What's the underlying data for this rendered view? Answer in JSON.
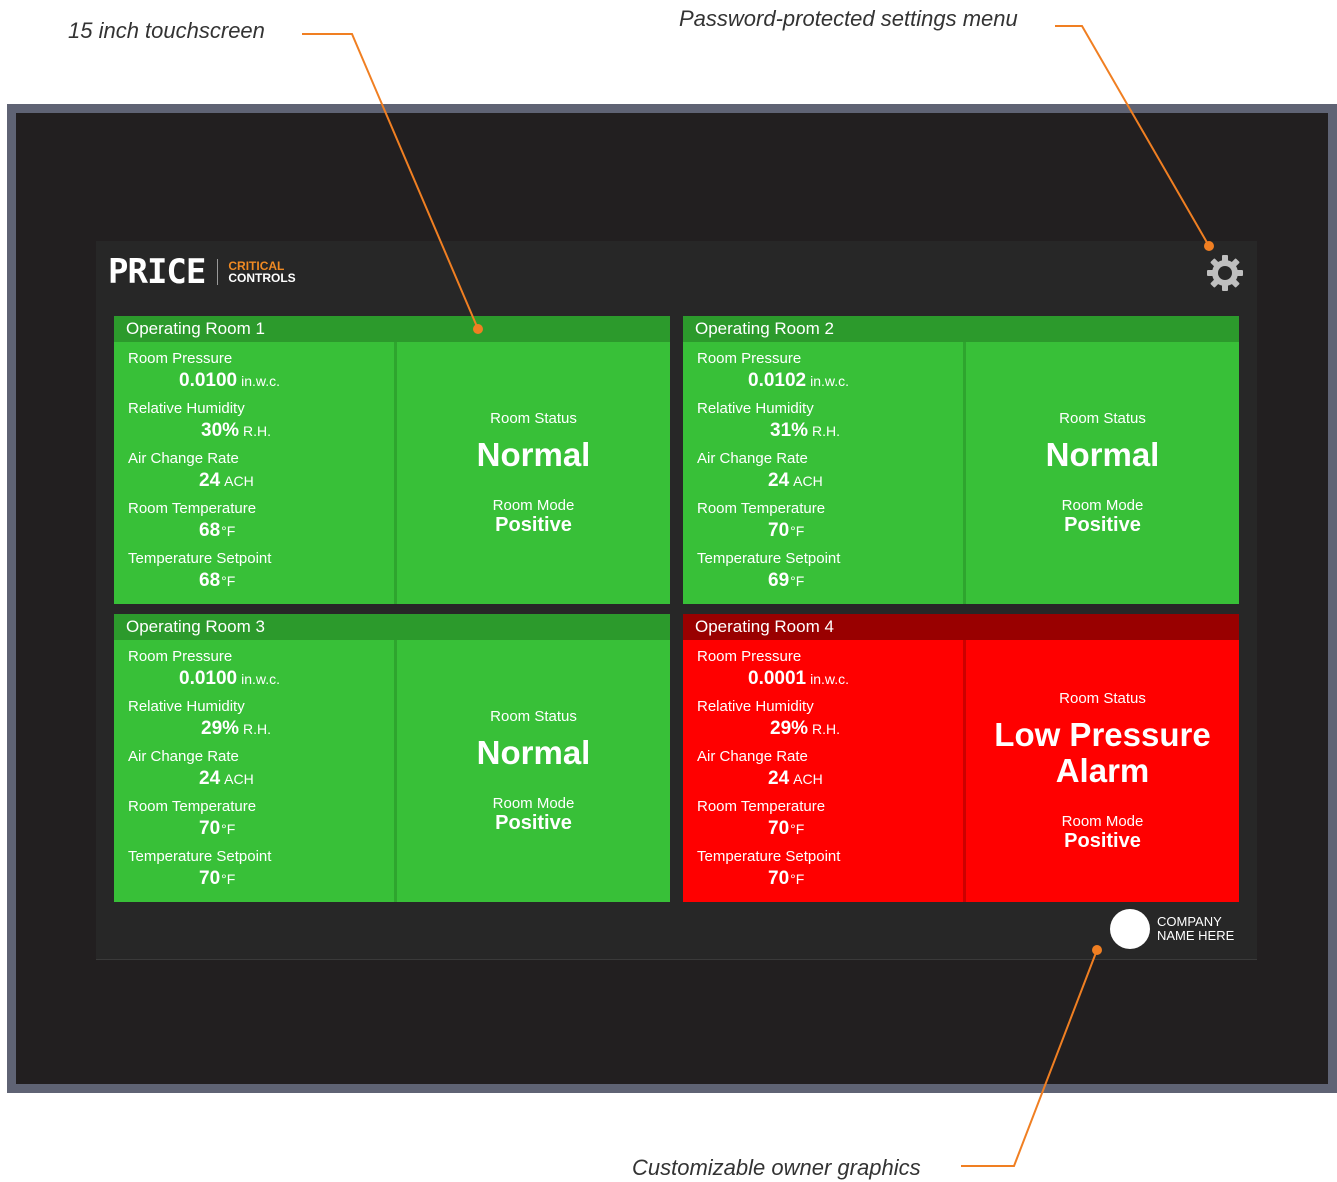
{
  "callouts": {
    "touchscreen": "15 inch touchscreen",
    "settings": "Password-protected settings menu",
    "owner": "Customizable owner graphics",
    "line_color": "#f07f22"
  },
  "header": {
    "logo_text": "PRICE",
    "logo_sub_line1": "CRITICAL",
    "logo_sub_line2": "CONTROLS",
    "settings_icon": "gear-icon"
  },
  "colors": {
    "normal_header": "#2c9a2c",
    "normal_body": "#38c038",
    "normal_divider": "#2ea52e",
    "alarm_header": "#990000",
    "alarm_body": "#ff0000",
    "alarm_divider": "#cc0000"
  },
  "rooms": [
    {
      "name": "Operating Room 1",
      "state": "normal",
      "metrics": [
        {
          "label": "Room Pressure",
          "value": "0.0100",
          "unit": "in.w.c."
        },
        {
          "label": "Relative Humidity",
          "value": "30%",
          "unit": "R.H."
        },
        {
          "label": "Air Change Rate",
          "value": "24",
          "unit": "ACH"
        },
        {
          "label": "Room Temperature",
          "value": "68",
          "unit": "°F"
        },
        {
          "label": "Temperature Setpoint",
          "value": "68",
          "unit": "°F"
        }
      ],
      "status_label": "Room Status",
      "status_value": "Normal",
      "mode_label": "Room Mode",
      "mode_value": "Positive"
    },
    {
      "name": "Operating Room 2",
      "state": "normal",
      "metrics": [
        {
          "label": "Room Pressure",
          "value": "0.0102",
          "unit": "in.w.c."
        },
        {
          "label": "Relative Humidity",
          "value": "31%",
          "unit": "R.H."
        },
        {
          "label": "Air Change Rate",
          "value": "24",
          "unit": "ACH"
        },
        {
          "label": "Room Temperature",
          "value": "70",
          "unit": "°F"
        },
        {
          "label": "Temperature Setpoint",
          "value": "69",
          "unit": "°F"
        }
      ],
      "status_label": "Room Status",
      "status_value": "Normal",
      "mode_label": "Room Mode",
      "mode_value": "Positive"
    },
    {
      "name": "Operating Room 3",
      "state": "normal",
      "metrics": [
        {
          "label": "Room Pressure",
          "value": "0.0100",
          "unit": "in.w.c."
        },
        {
          "label": "Relative Humidity",
          "value": "29%",
          "unit": "R.H."
        },
        {
          "label": "Air Change Rate",
          "value": "24",
          "unit": "ACH"
        },
        {
          "label": "Room Temperature",
          "value": "70",
          "unit": "°F"
        },
        {
          "label": "Temperature Setpoint",
          "value": "70",
          "unit": "°F"
        }
      ],
      "status_label": "Room Status",
      "status_value": "Normal",
      "mode_label": "Room Mode",
      "mode_value": "Positive"
    },
    {
      "name": "Operating Room 4",
      "state": "alarm",
      "metrics": [
        {
          "label": "Room Pressure",
          "value": "0.0001",
          "unit": "in.w.c."
        },
        {
          "label": "Relative Humidity",
          "value": "29%",
          "unit": "R.H."
        },
        {
          "label": "Air Change Rate",
          "value": "24",
          "unit": "ACH"
        },
        {
          "label": "Room Temperature",
          "value": "70",
          "unit": "°F"
        },
        {
          "label": "Temperature Setpoint",
          "value": "70",
          "unit": "°F"
        }
      ],
      "status_label": "Room Status",
      "status_value": "Low Pressure Alarm",
      "mode_label": "Room Mode",
      "mode_value": "Positive"
    }
  ],
  "footer": {
    "owner_line1": "COMPANY",
    "owner_line2": "NAME HERE"
  }
}
